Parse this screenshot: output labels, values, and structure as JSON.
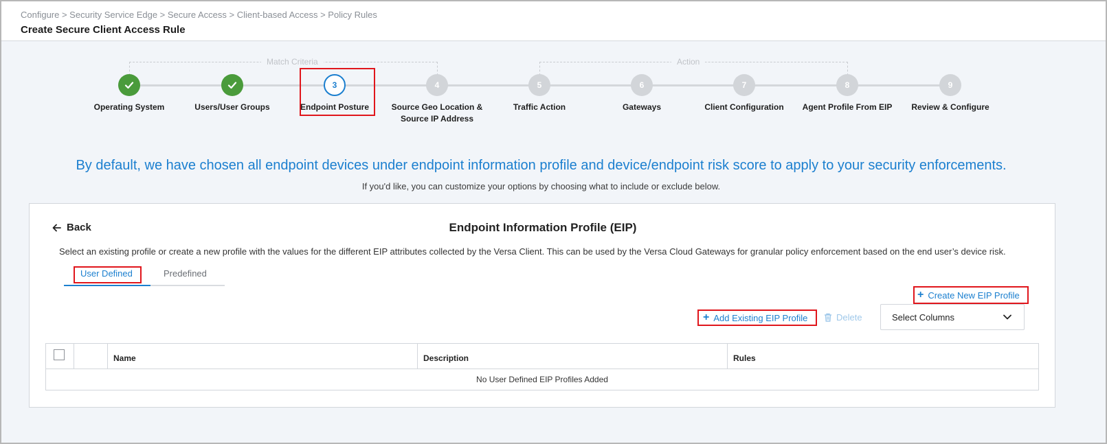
{
  "header": {
    "breadcrumb": "Configure > Security Service Edge > Secure Access > Client-based Access > Policy Rules",
    "title": "Create Secure Client Access Rule"
  },
  "stepper": {
    "groups": {
      "match_criteria": "Match Criteria",
      "action": "Action"
    },
    "steps": [
      {
        "number": "1",
        "label": "Operating System",
        "status": "done"
      },
      {
        "number": "2",
        "label": "Users/User Groups",
        "status": "done"
      },
      {
        "number": "3",
        "label": "Endpoint Posture",
        "status": "active"
      },
      {
        "number": "4",
        "label": "Source Geo Location & Source IP Address",
        "status": "pending"
      },
      {
        "number": "5",
        "label": "Traffic Action",
        "status": "pending"
      },
      {
        "number": "6",
        "label": "Gateways",
        "status": "pending"
      },
      {
        "number": "7",
        "label": "Client Configuration",
        "status": "pending"
      },
      {
        "number": "8",
        "label": "Agent Profile From EIP",
        "status": "pending"
      },
      {
        "number": "9",
        "label": "Review & Configure",
        "status": "pending"
      }
    ]
  },
  "hero": {
    "title": "By default, we have chosen all endpoint devices under endpoint information profile and device/endpoint risk score to apply to your security enforcements.",
    "subtitle": "If you'd like, you can customize your options by choosing what to include or exclude below."
  },
  "card": {
    "back_label": "Back",
    "title": "Endpoint Information Profile (EIP)",
    "description": "Select an existing profile or create a new profile with the values for the different EIP attributes collected by the Versa Client. This can be used by the Versa Cloud Gateways for granular policy enforcement based on the end user’s device risk.",
    "tabs": {
      "user_defined": "User Defined",
      "predefined": "Predefined"
    },
    "create_new": "Create New EIP Profile",
    "add_existing": "Add Existing EIP Profile",
    "delete": "Delete",
    "select_columns": "Select Columns",
    "table": {
      "columns": [
        "Name",
        "Description",
        "Rules"
      ],
      "empty_message": "No User Defined EIP Profiles Added"
    }
  },
  "colors": {
    "accent": "#1b7fcf",
    "done": "#4a9b3b",
    "pending": "#d2d5d9",
    "highlight": "#e0151b"
  }
}
